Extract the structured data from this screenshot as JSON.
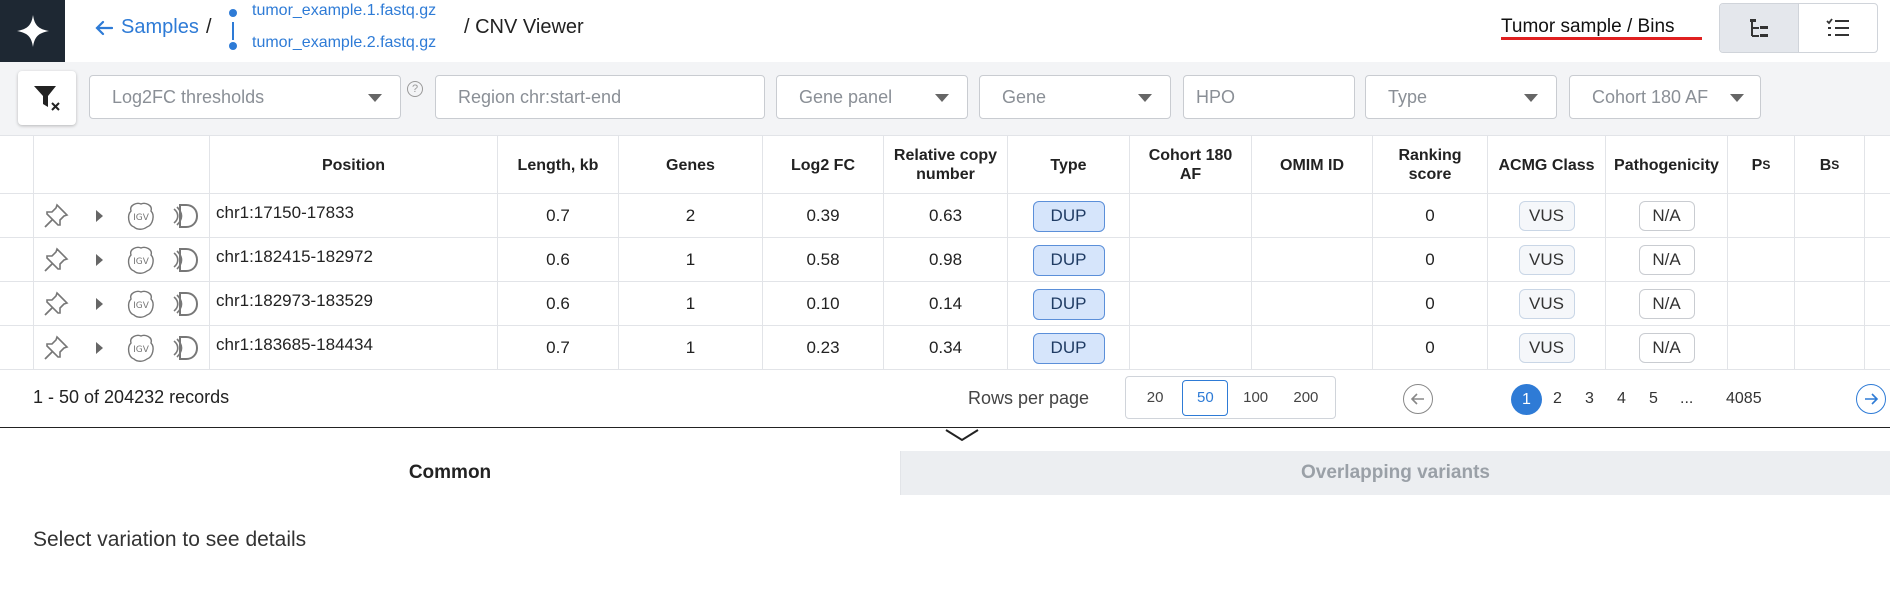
{
  "header": {
    "back_label": "Samples",
    "separator": "/",
    "files": [
      "tumor_example.1.fastq.gz",
      "tumor_example.2.fastq.gz"
    ],
    "crumb_last": "/ CNV Viewer",
    "sample_title": "Tumor sample / Bins"
  },
  "filters": {
    "log2fc": "Log2FC thresholds",
    "region": "Region chr:start-end",
    "gene_panel": "Gene panel",
    "gene": "Gene",
    "hpo": "HPO",
    "type": "Type",
    "cohort": "Cohort 180 AF",
    "help_glyph": "?"
  },
  "table": {
    "headers": {
      "position": "Position",
      "length": "Length, kb",
      "genes": "Genes",
      "log2fc": "Log2 FC",
      "rcn": "Relative copy number",
      "type": "Type",
      "cohort": "Cohort 180 AF",
      "omim": "OMIM ID",
      "ranking": "Ranking score",
      "acmg": "ACMG Class",
      "pathogenicity": "Pathogenicity",
      "ps": "P",
      "ps_sub": "S",
      "bs": "B",
      "bs_sub": "S"
    },
    "rows": [
      {
        "position": "chr1:17150-17833",
        "length": "0.7",
        "genes": "2",
        "log2fc": "0.39",
        "rcn": "0.63",
        "type": "DUP",
        "ranking": "0",
        "acmg": "VUS",
        "pathogenicity": "N/A"
      },
      {
        "position": "chr1:182415-182972",
        "length": "0.6",
        "genes": "1",
        "log2fc": "0.58",
        "rcn": "0.98",
        "type": "DUP",
        "ranking": "0",
        "acmg": "VUS",
        "pathogenicity": "N/A"
      },
      {
        "position": "chr1:182973-183529",
        "length": "0.6",
        "genes": "1",
        "log2fc": "0.10",
        "rcn": "0.14",
        "type": "DUP",
        "ranking": "0",
        "acmg": "VUS",
        "pathogenicity": "N/A"
      },
      {
        "position": "chr1:183685-184434",
        "length": "0.7",
        "genes": "1",
        "log2fc": "0.23",
        "rcn": "0.34",
        "type": "DUP",
        "ranking": "0",
        "acmg": "VUS",
        "pathogenicity": "N/A"
      }
    ]
  },
  "pagination": {
    "records": "1 - 50 of 204232 records",
    "rows_per_page_label": "Rows per page",
    "rows_per_page_options": [
      "20",
      "50",
      "100",
      "200"
    ],
    "selected_rows": "50",
    "pages": [
      "1",
      "2",
      "3",
      "4",
      "5",
      "...",
      "4085"
    ],
    "current_page": "1"
  },
  "details": {
    "tab_common": "Common",
    "tab_overlapping": "Overlapping variants",
    "message": "Select variation to see details"
  },
  "colors": {
    "accent": "#2e7bd6",
    "logo_bg": "#1e2833",
    "underline": "#e02020",
    "dup_chip": "#d6e5fb"
  },
  "icons": {
    "logo": "sparkle-icon",
    "back": "arrow-left-icon",
    "filter": "filter-clear-icon",
    "pin": "pin-icon",
    "expand": "caret-right-icon",
    "igv": "igv-icon",
    "decipher": "decipher-icon",
    "prev": "arrow-left-circle-icon",
    "next": "arrow-right-circle-icon",
    "collapse": "chevron-down-icon",
    "tree_view": "tree-view-icon",
    "list_view": "list-view-icon"
  }
}
